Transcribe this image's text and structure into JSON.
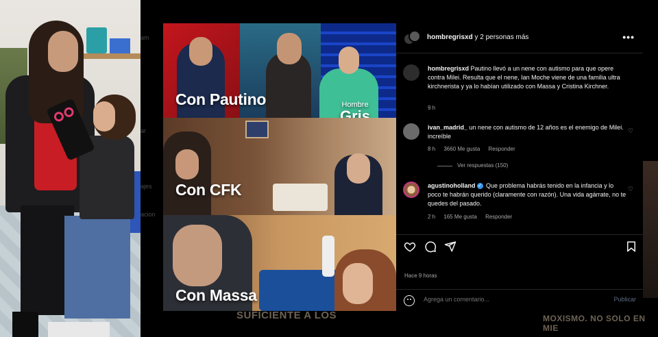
{
  "background_page": {
    "menu_fragments": [
      "am",
      "ar",
      "ajes",
      "acion"
    ],
    "caption_left": "SUFICIENTE A LOS",
    "caption_right": "MOXISMO. NO SOLO EN MIE"
  },
  "post_image": {
    "panels": [
      {
        "caption": "Con Pautino"
      },
      {
        "caption": "Con CFK"
      },
      {
        "caption": "Con Massa"
      }
    ],
    "watermark_small": "Hombre",
    "watermark_big": "Gris"
  },
  "header": {
    "username": "hombregrisxd",
    "collab_text": "y 2 personas más",
    "more_icon": "more-horizontal-icon"
  },
  "comments": [
    {
      "username": "hombregrisxd",
      "text": "Pautino llevó a un nene con autismo para que opere contra Milei. Resulta que el nene, Ian Moche viene de una familia ultra kirchnerista y ya lo habían utilizado con Massa y Cristina Kirchner.",
      "time": "9 h"
    },
    {
      "username": "ivan_madrid_",
      "text": "un nene con autismo de 12 años es el enemigo de Milei. increíble",
      "time": "8 h",
      "likes": "3660 Me gusta",
      "reply": "Responder",
      "view_replies": "Ver respuestas (150)"
    },
    {
      "username": "agustinoholland",
      "verified": true,
      "text": "Que problema habrás tenido en la infancia y lo poco te habrán querido (claramente con razón). Una vida agárrate, no te quedes del pasado.",
      "time": "2 h",
      "likes": "165 Me gusta",
      "reply": "Responder"
    }
  ],
  "actions": {
    "icons": [
      "heart-icon",
      "comment-icon",
      "share-icon",
      "bookmark-icon"
    ]
  },
  "timestamp": "Hace 9 horas",
  "add_comment": {
    "placeholder": "Agrega un comentario...",
    "publish_label": "Publicar"
  }
}
